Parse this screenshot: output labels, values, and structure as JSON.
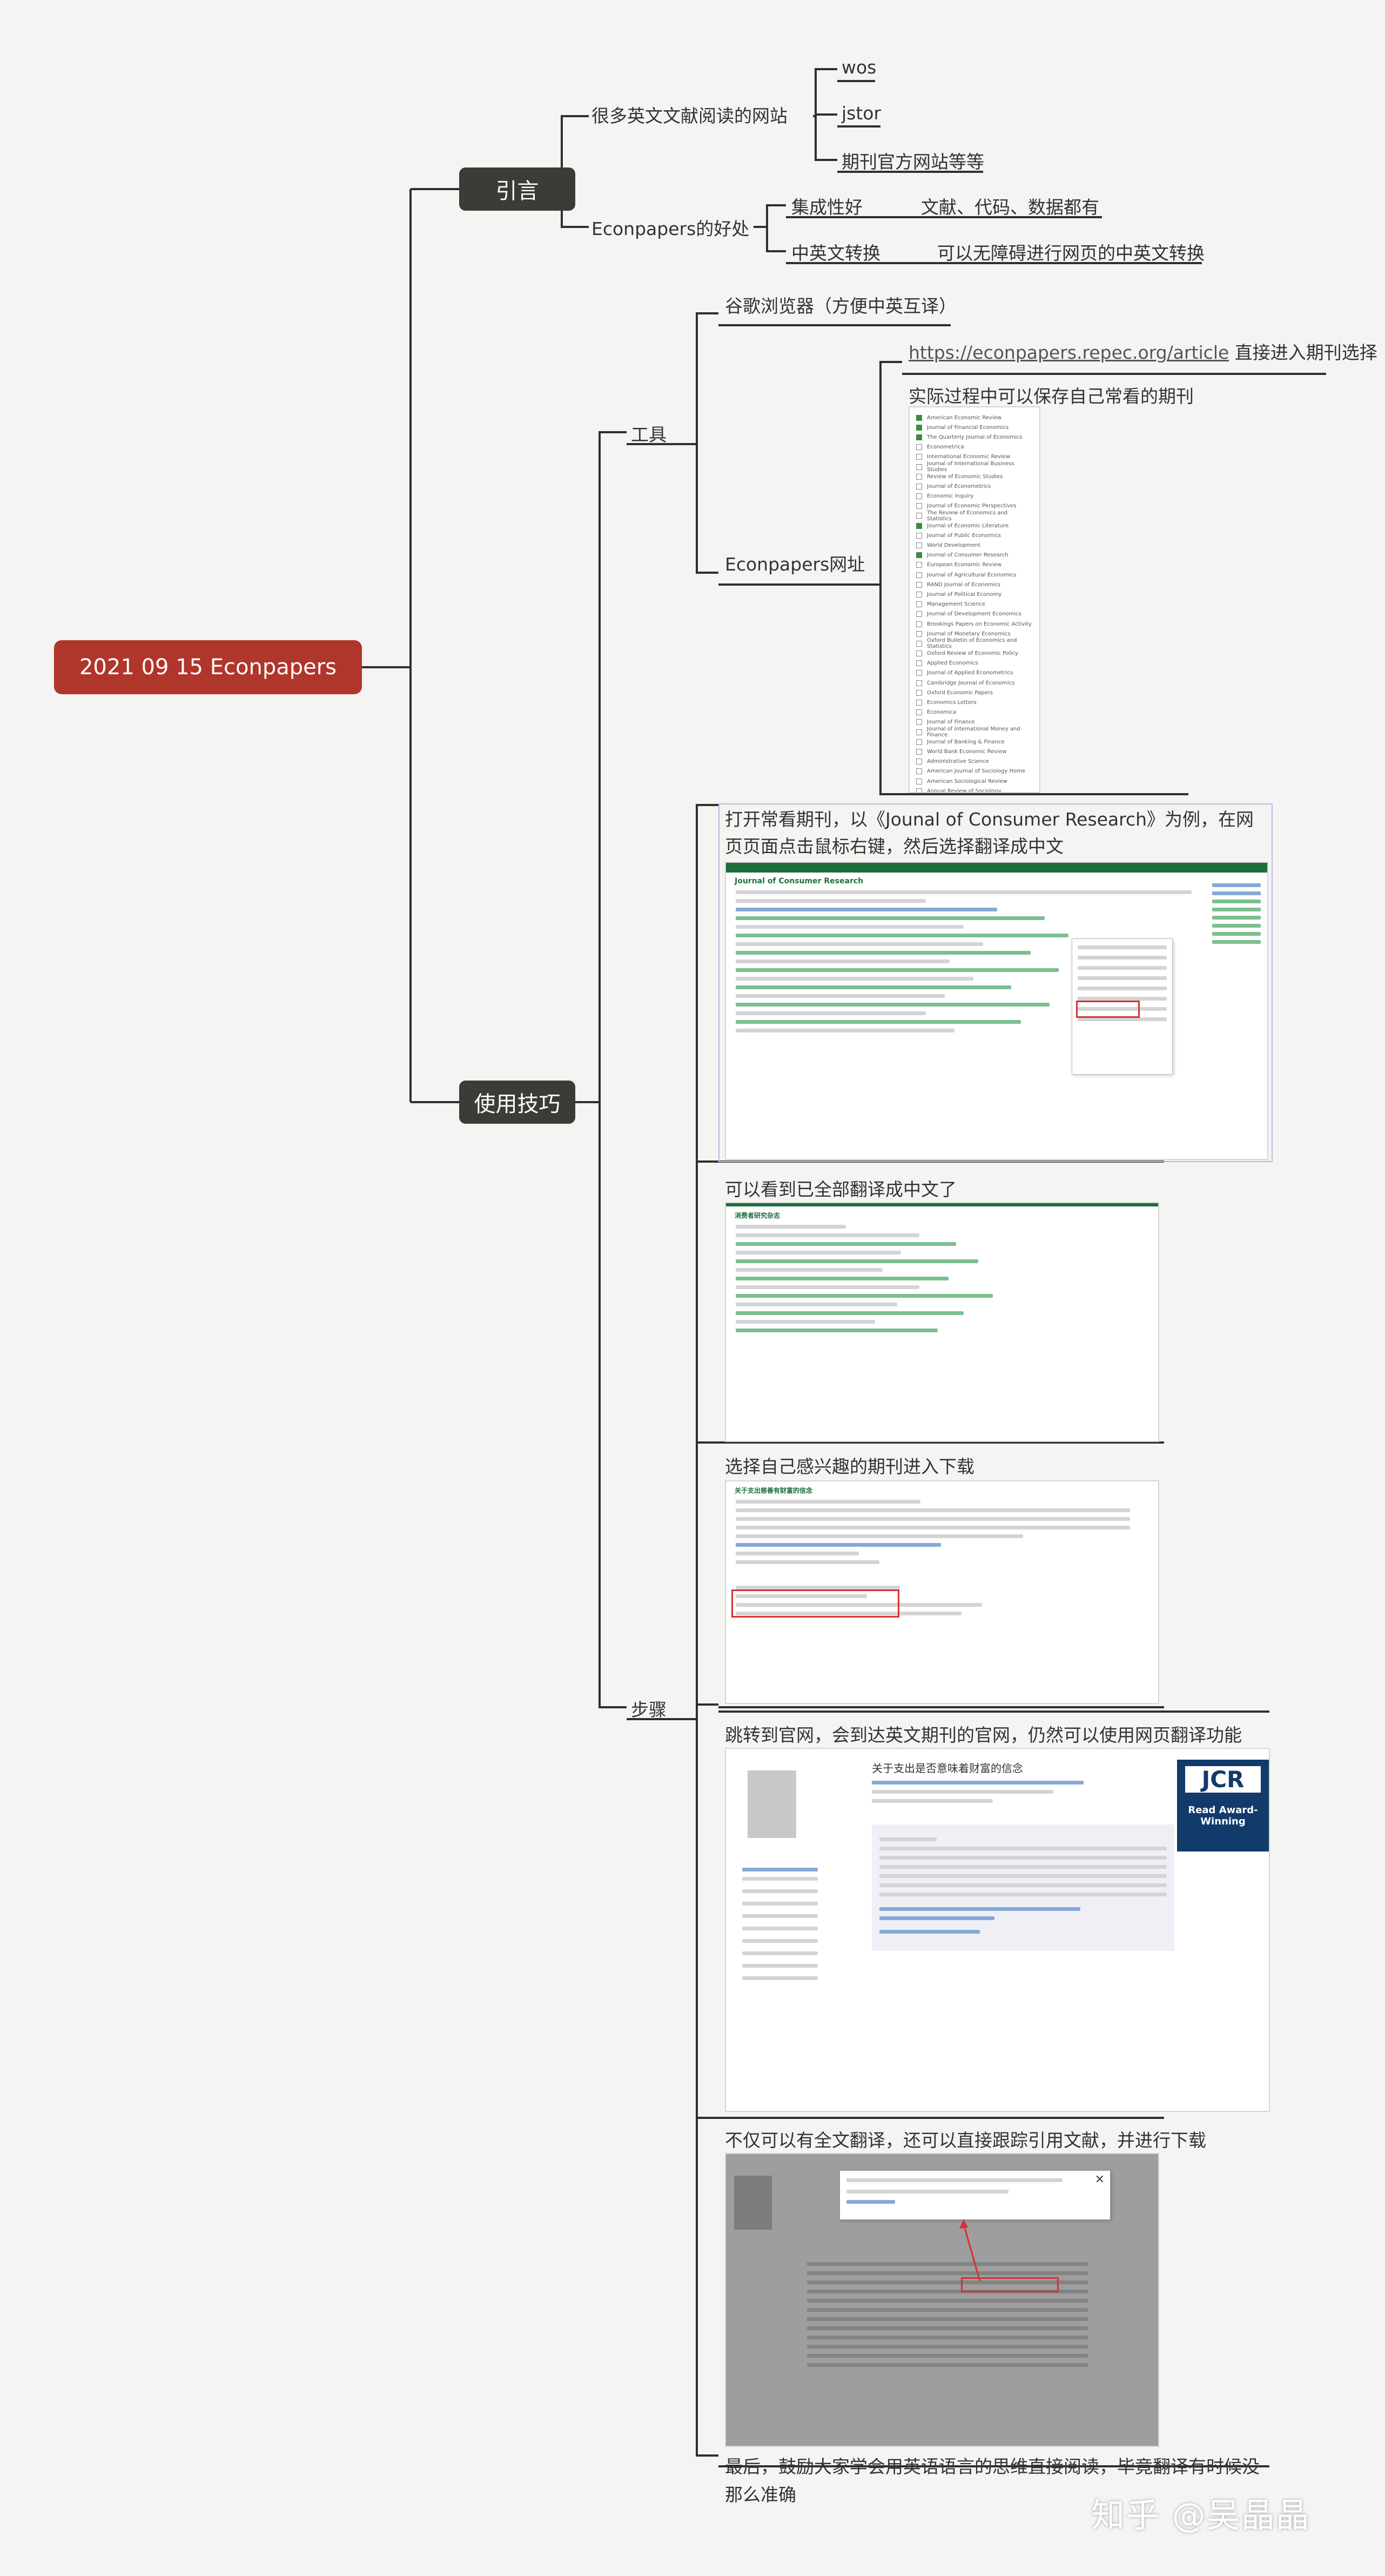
{
  "root": {
    "label": "2021 09 15 Econpapers"
  },
  "intro": {
    "label": "引言",
    "sites": {
      "label": "很多英文文献阅读的网站",
      "items": [
        "wos",
        "jstor",
        "期刊官方网站等等"
      ]
    },
    "benefits": {
      "label": "Econpapers的好处",
      "items": [
        {
          "label": "集成性好",
          "detail": "文献、代码、数据都有"
        },
        {
          "label": "中英文转换",
          "detail": "可以无障碍进行网页的中英文转换"
        }
      ]
    }
  },
  "tips": {
    "label": "使用技巧",
    "tools": {
      "label": "工具",
      "browser": "谷歌浏览器（方便中英互译）",
      "econpapers_label": "Econpapers网址",
      "url": "https://econpapers.repec.org/article",
      "url_suffix": "直接进入期刊选择",
      "save_label": "实际过程中可以保存自己常看的期刊",
      "journals": [
        {
          "name": "American Economic Review",
          "checked": true
        },
        {
          "name": "Journal of Financial Economics",
          "checked": true
        },
        {
          "name": "The Quarterly Journal of Economics",
          "checked": true
        },
        {
          "name": "Econometrica",
          "checked": false
        },
        {
          "name": "International Economic Review",
          "checked": false
        },
        {
          "name": "Journal of International Business Studies",
          "checked": false
        },
        {
          "name": "Review of Economic Studies",
          "checked": false
        },
        {
          "name": "Journal of Econometrics",
          "checked": false
        },
        {
          "name": "Economic Inquiry",
          "checked": false
        },
        {
          "name": "Journal of Economic Perspectives",
          "checked": false
        },
        {
          "name": "The Review of Economics and Statistics",
          "checked": false
        },
        {
          "name": "Journal of Economic Literature",
          "checked": true
        },
        {
          "name": "Journal of Public Economics",
          "checked": false
        },
        {
          "name": "World Development",
          "checked": false
        },
        {
          "name": "Journal of Consumer Research",
          "checked": true
        },
        {
          "name": "European Economic Review",
          "checked": false
        },
        {
          "name": "Journal of Agricultural Economics",
          "checked": false
        },
        {
          "name": "RAND Journal of Economics",
          "checked": false
        },
        {
          "name": "Journal of Political Economy",
          "checked": false
        },
        {
          "name": "Management Science",
          "checked": false
        },
        {
          "name": "Journal of Development Economics",
          "checked": false
        },
        {
          "name": "Brookings Papers on Economic Activity",
          "checked": false
        },
        {
          "name": "Journal of Monetary Economics",
          "checked": false
        },
        {
          "name": "Oxford Bulletin of Economics and Statistics",
          "checked": false
        },
        {
          "name": "Oxford Review of Economic Policy",
          "checked": false
        },
        {
          "name": "Applied Economics",
          "checked": false
        },
        {
          "name": "Journal of Applied Econometrics",
          "checked": false
        },
        {
          "name": "Cambridge Journal of Economics",
          "checked": false
        },
        {
          "name": "Oxford Economic Papers",
          "checked": false
        },
        {
          "name": "Economics Letters",
          "checked": false
        },
        {
          "name": "Economica",
          "checked": false
        },
        {
          "name": "Journal of Finance",
          "checked": false
        },
        {
          "name": "Journal of International Money and Finance",
          "checked": false
        },
        {
          "name": "Journal of Banking & Finance",
          "checked": false
        },
        {
          "name": "World Bank Economic Review",
          "checked": false
        },
        {
          "name": "Administrative Science",
          "checked": false
        },
        {
          "name": "American Journal of Sociology Home",
          "checked": false
        },
        {
          "name": "American Sociological Review",
          "checked": false
        },
        {
          "name": "Annual Review of Sociology",
          "checked": false
        }
      ]
    },
    "steps": {
      "label": "步骤",
      "items": [
        {
          "text": "打开常看期刊，以《Jounal of Consumer Research》为例，在网页页面点击鼠标右键，然后选择翻译成中文",
          "shot_title": "Journal of Consumer Research"
        },
        {
          "text": "可以看到已全部翻译成中文了",
          "shot_title": "消费者研究杂志"
        },
        {
          "text": "选择自己感兴趣的期刊进入下载",
          "shot_title": "关于支出慈善有财富的信念"
        },
        {
          "text": "跳转到官网，会到达英文期刊的官网，仍然可以使用网页翻译功能",
          "shot_title": "关于支出是否意味着财富的信念",
          "jcr": "JCR",
          "award": "Read Award-Winning"
        },
        {
          "text": "不仅可以有全文翻译，还可以直接跟踪引用文献，并进行下载"
        },
        {
          "text": "最后，鼓励大家学会用英语语言的思维直接阅读，毕竟翻译有时候没那么准确"
        }
      ]
    }
  },
  "watermark": "知乎 @吴晶晶"
}
